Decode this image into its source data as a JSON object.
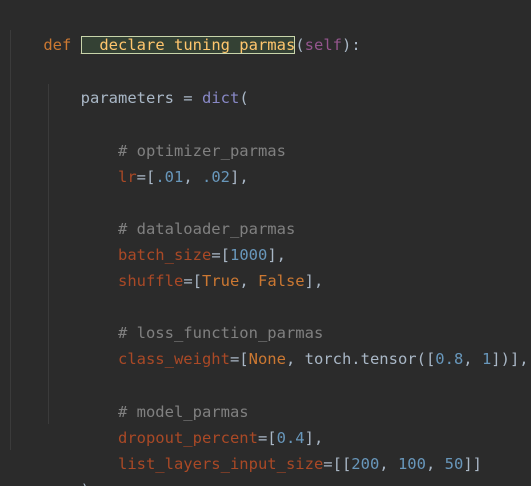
{
  "editor": {
    "colors": {
      "background": "#2b2b2b",
      "keyword": "#cc7832",
      "function_name": "#ffc66d",
      "self": "#94558d",
      "default_text": "#a9b7c6",
      "builtin": "#8888c6",
      "comment": "#808080",
      "named_argument": "#aa4926",
      "number": "#6897bb",
      "highlight_background": "#344134"
    },
    "line1": {
      "def": "def",
      "space": " ",
      "name": "__declare_tuning_parmas",
      "open_paren": "(",
      "self": "self",
      "close": "):"
    },
    "line2": {
      "indent": "    ",
      "var": "parameters = ",
      "dict": "dict",
      "open": "("
    },
    "line3": {
      "indent": "        ",
      "comment": "# optimizer_parmas"
    },
    "line4": {
      "indent": "        ",
      "name": "lr",
      "eq": "=[",
      "v1": ".01",
      "sep": ", ",
      "v2": ".02",
      "close": "],"
    },
    "line5": {
      "indent": "        ",
      "comment": "# dataloader_parmas"
    },
    "line6": {
      "indent": "        ",
      "name": "batch_size",
      "eq": "=[",
      "v1": "1000",
      "close": "],"
    },
    "line7": {
      "indent": "        ",
      "name": "shuffle",
      "eq": "=[",
      "v1": "True",
      "sep": ", ",
      "v2": "False",
      "close": "],"
    },
    "line8": {
      "indent": "        ",
      "comment": "# loss_function_parmas"
    },
    "line9": {
      "indent": "        ",
      "name": "class_weight",
      "eq": "=[",
      "v1": "None",
      "mid": ", torch.tensor([",
      "v2": "0.8",
      "sep": ", ",
      "v3": "1",
      "close": "])],"
    },
    "line10": {
      "indent": "        ",
      "comment": "# model_parmas"
    },
    "line11": {
      "indent": "        ",
      "name": "dropout_percent",
      "eq": "=[",
      "v1": "0.4",
      "close": "],"
    },
    "line12": {
      "indent": "        ",
      "name": "list_layers_input_size",
      "eq": "=[[",
      "v1": "200",
      "sep1": ", ",
      "v2": "100",
      "sep2": ", ",
      "v3": "50",
      "close": "]]"
    },
    "line13": {
      "indent": "    ",
      "close": ")"
    }
  }
}
